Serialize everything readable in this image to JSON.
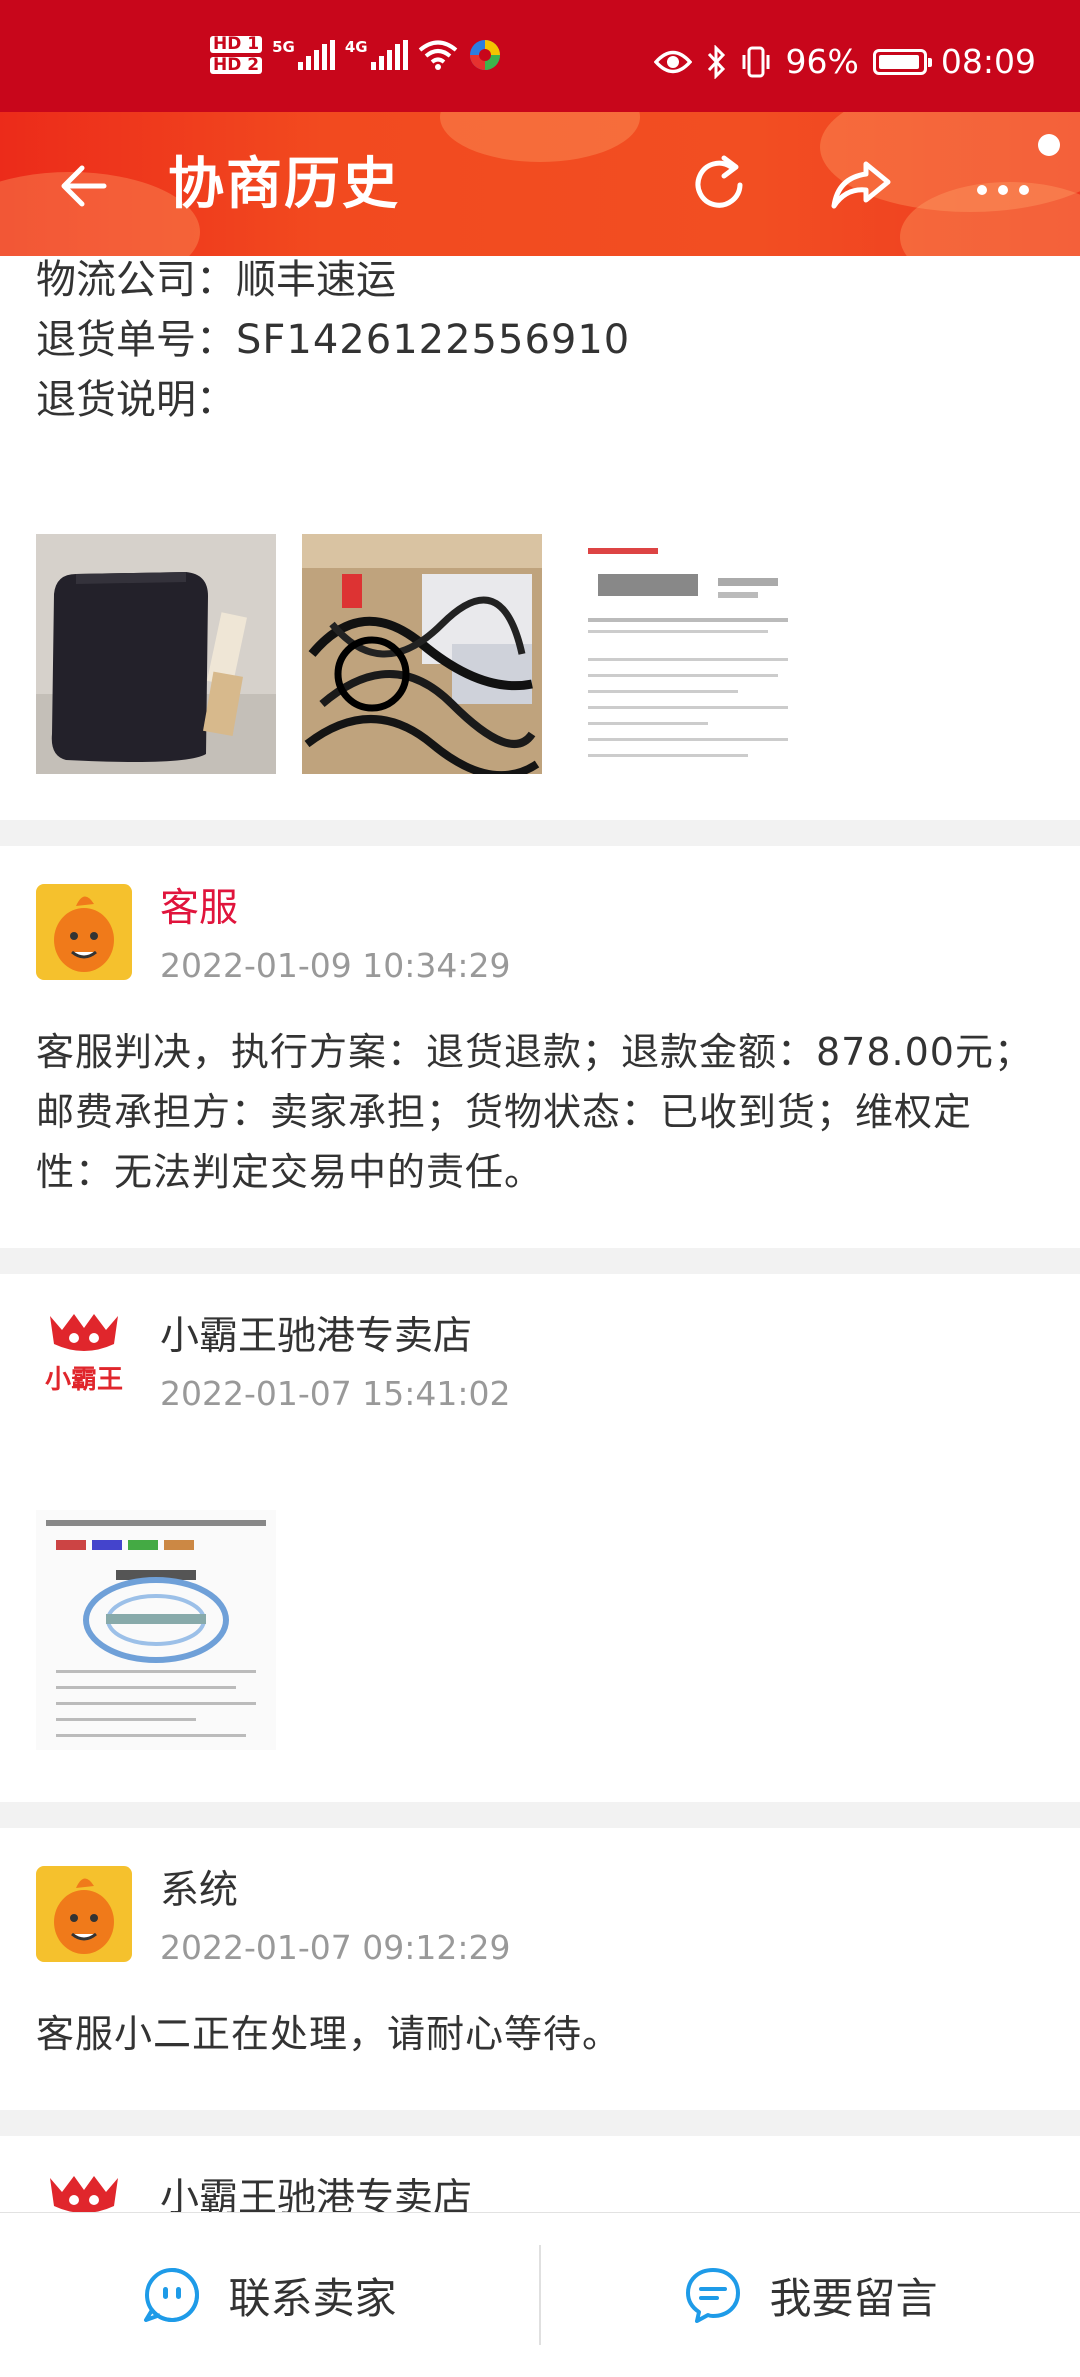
{
  "status_bar": {
    "hd1": "HD 1",
    "hd2": "HD 2",
    "net1": "5G",
    "net2": "4G",
    "battery_pct": "96%",
    "battery_level": 0.96,
    "time": "08:09"
  },
  "header": {
    "title": "协商历史",
    "back_icon": "arrow-left-icon",
    "refresh_icon": "refresh-icon",
    "share_icon": "share-icon",
    "more_icon": "more-dots-icon"
  },
  "return_info": {
    "logistics_label": "物流公司：",
    "logistics_value": "顺丰速运",
    "tracking_label": "退货单号：",
    "tracking_value": "SF1426122556910",
    "note_label": "退货说明："
  },
  "records": [
    {
      "author": "客服",
      "time": "2022-01-09 10:34:29",
      "message": "客服判决，执行方案：退货退款；退款金额：878.00元；邮费承担方：卖家承担；货物状态：已收到货；维权定性：无法判定交易中的责任。"
    },
    {
      "author": "小霸王驰港专卖店",
      "time": "2022-01-07 15:41:02",
      "logo_text": "小霸王"
    },
    {
      "author": "系统",
      "time": "2022-01-07 09:12:29",
      "message": "客服小二正在处理，请耐心等待。"
    },
    {
      "author": "小霸王驰港专卖店"
    }
  ],
  "bottom": {
    "contact_seller": "联系卖家",
    "leave_message": "我要留言"
  },
  "colors": {
    "status_bar": "#c8061b",
    "header": "#f24a1f",
    "accent_red": "#e0143c",
    "icon_blue": "#1e9be8"
  }
}
